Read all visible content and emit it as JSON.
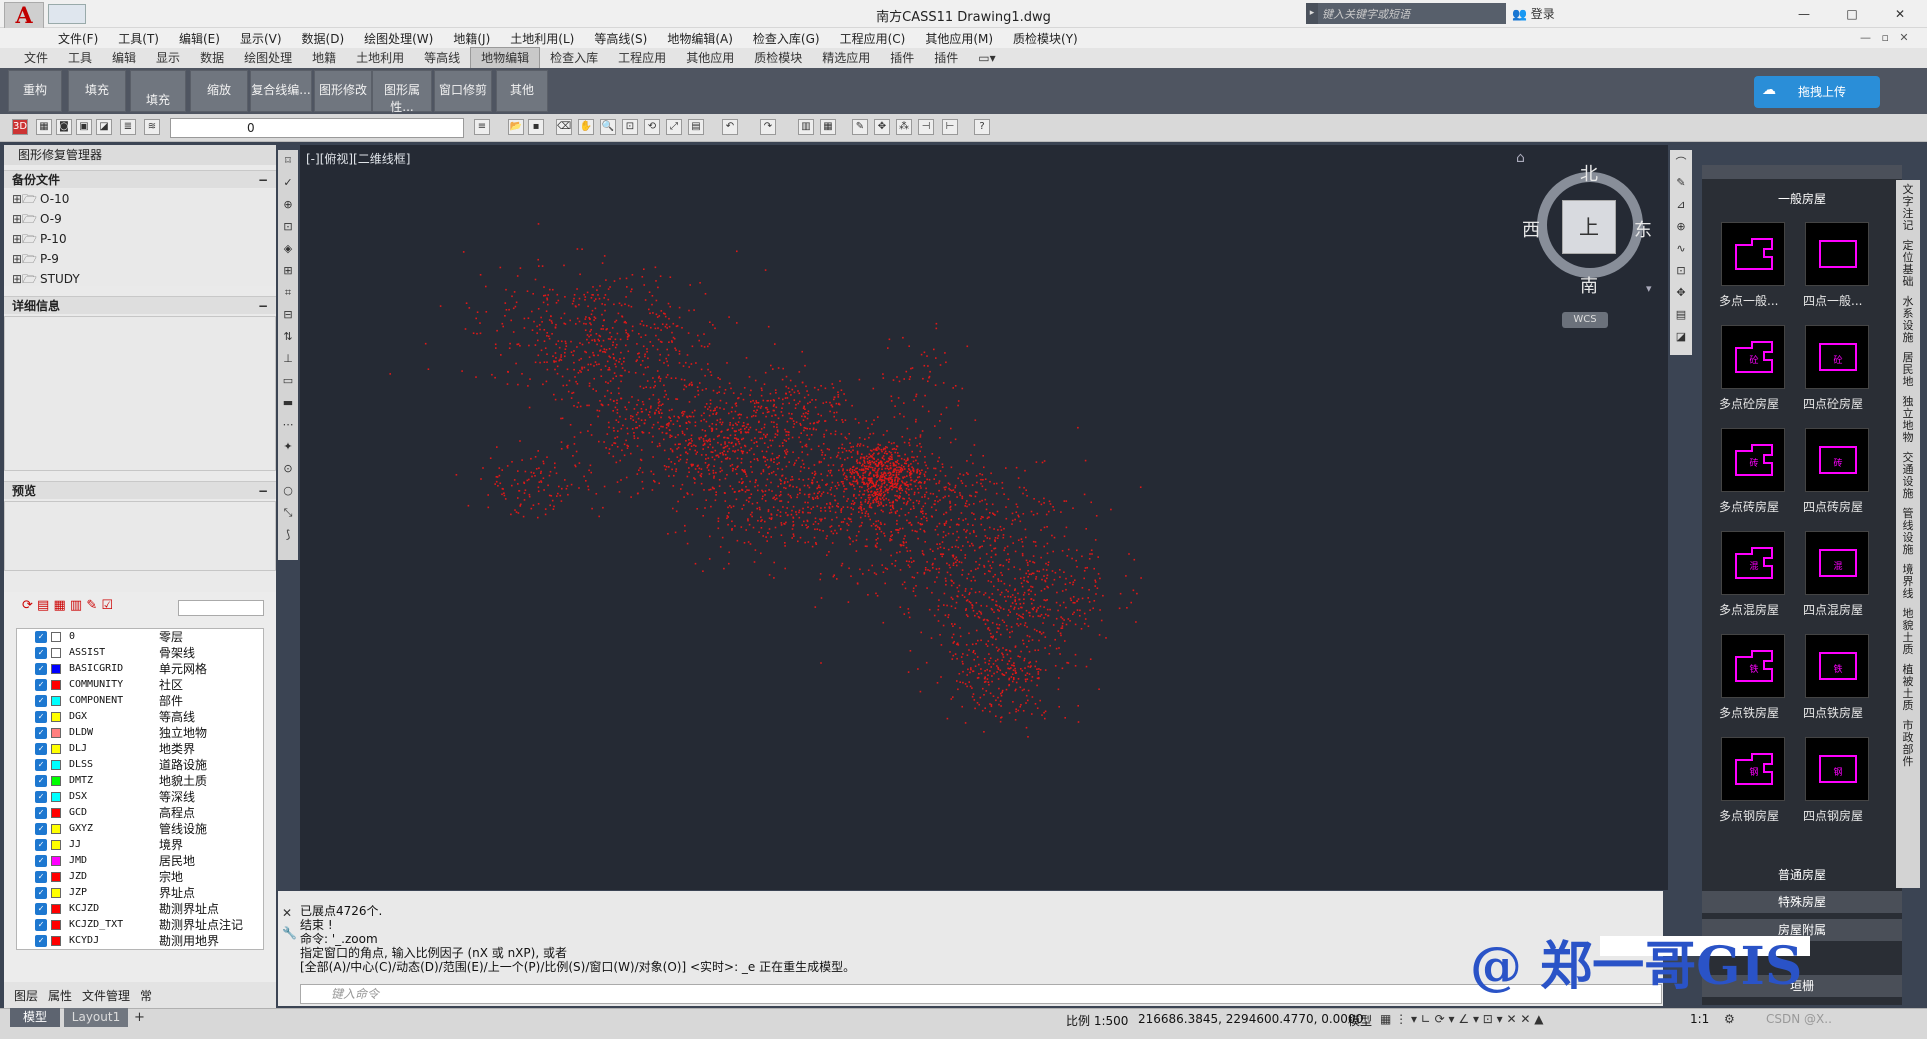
{
  "app": {
    "logo_letter": "A",
    "title": "南方CASS11    Drawing1.dwg",
    "search_placeholder": "键入关键字或短语",
    "login": "登录",
    "window_min": "—",
    "window_max": "□",
    "window_close": "✕"
  },
  "menubar": [
    "文件(F)",
    "工具(T)",
    "编辑(E)",
    "显示(V)",
    "数据(D)",
    "绘图处理(W)",
    "地籍(J)",
    "土地利用(L)",
    "等高线(S)",
    "地物编辑(A)",
    "检查入库(G)",
    "工程应用(C)",
    "其他应用(M)",
    "质检模块(Y)"
  ],
  "ribbon_tabs": [
    "文件",
    "工具",
    "编辑",
    "显示",
    "数据",
    "绘图处理",
    "地籍",
    "土地利用",
    "等高线",
    "地物编辑",
    "检查入库",
    "工程应用",
    "其他应用",
    "质检模块",
    "精选应用",
    "插件",
    "插件"
  ],
  "ribbon_active": "地物编辑",
  "ribbon_buttons": [
    "重构",
    "填充",
    "填充",
    "缩放",
    "复合线编...",
    "图形修改",
    "图形属性...",
    "窗口修剪",
    "其他"
  ],
  "upload_button": "拖拽上传",
  "layer_combo_value": "0",
  "left": {
    "title": "图形修复管理器",
    "backup_header": "备份文件",
    "backup_files": [
      "O-10",
      "O-9",
      "P-10",
      "P-9",
      "STUDY"
    ],
    "detail_header": "详细信息",
    "preview_header": "预览",
    "layers": [
      {
        "name": "0",
        "desc": "零层",
        "color": "#ffffff"
      },
      {
        "name": "ASSIST",
        "desc": "骨架线",
        "color": "#ffffff"
      },
      {
        "name": "BASICGRID",
        "desc": "单元网格",
        "color": "#0000ff"
      },
      {
        "name": "COMMUNITY",
        "desc": "社区",
        "color": "#ff0000"
      },
      {
        "name": "COMPONENT",
        "desc": "部件",
        "color": "#00ffff"
      },
      {
        "name": "DGX",
        "desc": "等高线",
        "color": "#ffff00"
      },
      {
        "name": "DLDW",
        "desc": "独立地物",
        "color": "#ff7f7f"
      },
      {
        "name": "DLJ",
        "desc": "地类界",
        "color": "#ffff00"
      },
      {
        "name": "DLSS",
        "desc": "道路设施",
        "color": "#00ffff"
      },
      {
        "name": "DMTZ",
        "desc": "地貌土质",
        "color": "#00ff00"
      },
      {
        "name": "DSX",
        "desc": "等深线",
        "color": "#00ffff"
      },
      {
        "name": "GCD",
        "desc": "高程点",
        "color": "#ff0000"
      },
      {
        "name": "GXYZ",
        "desc": "管线设施",
        "color": "#ffff00"
      },
      {
        "name": "JJ",
        "desc": "境界",
        "color": "#ffff00"
      },
      {
        "name": "JMD",
        "desc": "居民地",
        "color": "#ff00ff"
      },
      {
        "name": "JZD",
        "desc": "宗地",
        "color": "#ff0000"
      },
      {
        "name": "JZP",
        "desc": "界址点",
        "color": "#ffff00"
      },
      {
        "name": "KCJZD",
        "desc": "勘测界址点",
        "color": "#ff0000"
      },
      {
        "name": "KCJZD_TXT",
        "desc": "勘测界址点注记",
        "color": "#ff0000"
      },
      {
        "name": "KCYDJ",
        "desc": "勘测用地界",
        "color": "#ff0000"
      }
    ],
    "tabs": [
      "图层",
      "属性",
      "文件管理",
      "常"
    ]
  },
  "canvas": {
    "view_label": "[-][俯视][二维线框]",
    "compass_north": "北",
    "compass_south": "南",
    "compass_east": "东",
    "compass_west": "西",
    "compass_top": "上",
    "wcs": "WCS",
    "point_color": "#e01818"
  },
  "command": {
    "lines": [
      "已展点4726个.",
      "结束 !",
      "命令: '_.zoom",
      "指定窗口的角点, 输入比例因子 (nX 或 nXP), 或者",
      "[全部(A)/中心(C)/动态(D)/范围(E)/上一个(P)/比例(S)/窗口(W)/对象(O)] <实时>: _e 正在重生成模型。"
    ],
    "input_placeholder": "键入命令"
  },
  "palette": {
    "header_top": "一般房屋",
    "tiles": [
      [
        "多点一般...",
        "四点一般..."
      ],
      [
        "多点砼房屋",
        "四点砼房屋"
      ],
      [
        "多点砖房屋",
        "四点砖房屋"
      ],
      [
        "多点混房屋",
        "四点混房屋"
      ],
      [
        "多点铁房屋",
        "四点铁房屋"
      ],
      [
        "多点钢房屋",
        "四点钢房屋"
      ]
    ],
    "tile_glyphs": [
      "",
      "砼",
      "砖",
      "混",
      "铁",
      "钢"
    ],
    "footers": [
      "普通房屋",
      "特殊房屋",
      "房屋附属",
      "垣栅"
    ],
    "side_tabs": [
      "文字注记",
      "定位基础",
      "水系设施",
      "居民地",
      "独立地物",
      "交通设施",
      "管线设施",
      "境界线",
      "地貌土质",
      "植被土质",
      "市政部件"
    ],
    "accent": "#ff00ff"
  },
  "status": {
    "model_tab": "模型",
    "layout_tab": "Layout1",
    "scale": "比例 1:500",
    "coords": "216686.3845, 2294600.4770, 0.0000",
    "model": "模型",
    "ratio": "1:1"
  },
  "watermark": "@ 郑一哥GIS",
  "csdn": "CSDN @X.."
}
